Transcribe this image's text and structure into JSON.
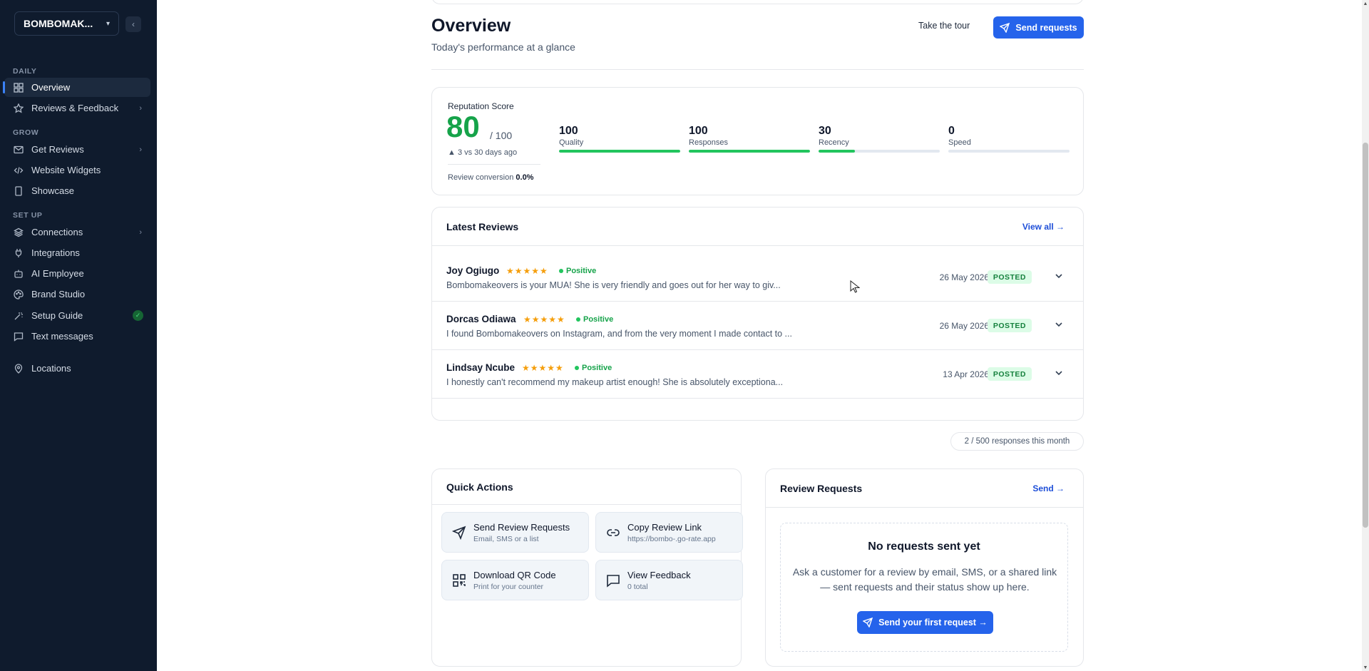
{
  "sidebar": {
    "brand": "BOMBOMAK...",
    "sections": {
      "daily": "DAILY",
      "grow": "GROW",
      "setup": "SET UP"
    },
    "items": [
      {
        "label": "Overview"
      },
      {
        "label": "Reviews & Feedback"
      },
      {
        "label": "Get Reviews"
      },
      {
        "label": "Website Widgets"
      },
      {
        "label": "Showcase"
      },
      {
        "label": "Connections"
      },
      {
        "label": "Integrations"
      },
      {
        "label": "AI Employee"
      },
      {
        "label": "Brand Studio"
      },
      {
        "label": "Setup Guide"
      },
      {
        "label": "Text messages"
      },
      {
        "label": "Locations"
      }
    ]
  },
  "header": {
    "title": "Overview",
    "subtitle": "Today's performance at a glance",
    "tour_label": "Take the tour",
    "send_label": "Send requests"
  },
  "reputation": {
    "label": "Reputation Score",
    "score": "80",
    "max": "/ 100",
    "delta": "▲ 3 vs 30 days ago",
    "conversion_label": "Review conversion",
    "conversion_value": "0.0%",
    "metrics": [
      {
        "value": "100",
        "label": "Quality",
        "fill": 1.0
      },
      {
        "value": "100",
        "label": "Responses",
        "fill": 1.0
      },
      {
        "value": "30",
        "label": "Recency",
        "fill": 0.3
      },
      {
        "value": "0",
        "label": "Speed",
        "fill": 0.0
      }
    ]
  },
  "latest_reviews": {
    "title": "Latest Reviews",
    "view_all": "View all →",
    "stars": "★★★★★",
    "sentiment": "Positive",
    "status": "POSTED",
    "rows": [
      {
        "name": "Joy Ogiugo",
        "text": "Bombomakeovers is your MUA! She is very friendly and goes out for her way to giv...",
        "date": "26 May 2026"
      },
      {
        "name": "Dorcas Odiawa",
        "text": "I found Bombomakeovers on Instagram, and from the very moment I made contact to ...",
        "date": "26 May 2026"
      },
      {
        "name": "Lindsay Ncube",
        "text": "I honestly can't recommend my makeup artist enough! She is absolutely exceptiona...",
        "date": "13 Apr 2026"
      }
    ]
  },
  "responses_pill": "2 / 500 responses this month",
  "quick_actions": {
    "title": "Quick Actions",
    "tiles": [
      {
        "label": "Send Review Requests",
        "sub": "Email, SMS or a list"
      },
      {
        "label": "Copy Review Link",
        "sub": "https://bombo-.go-rate.app"
      },
      {
        "label": "Download QR Code",
        "sub": "Print for your counter"
      },
      {
        "label": "View Feedback",
        "sub": "0 total"
      }
    ]
  },
  "review_requests": {
    "title": "Review Requests",
    "send": "Send →",
    "empty_title": "No requests sent yet",
    "empty_desc": "Ask a customer for a review by email, SMS, or a shared link — sent requests and their status show up here.",
    "empty_button": "Send your first request →"
  },
  "colors": {
    "accent": "#2563eb",
    "score_green": "#16a34a",
    "sidebar_bg": "#0f1b2d"
  }
}
